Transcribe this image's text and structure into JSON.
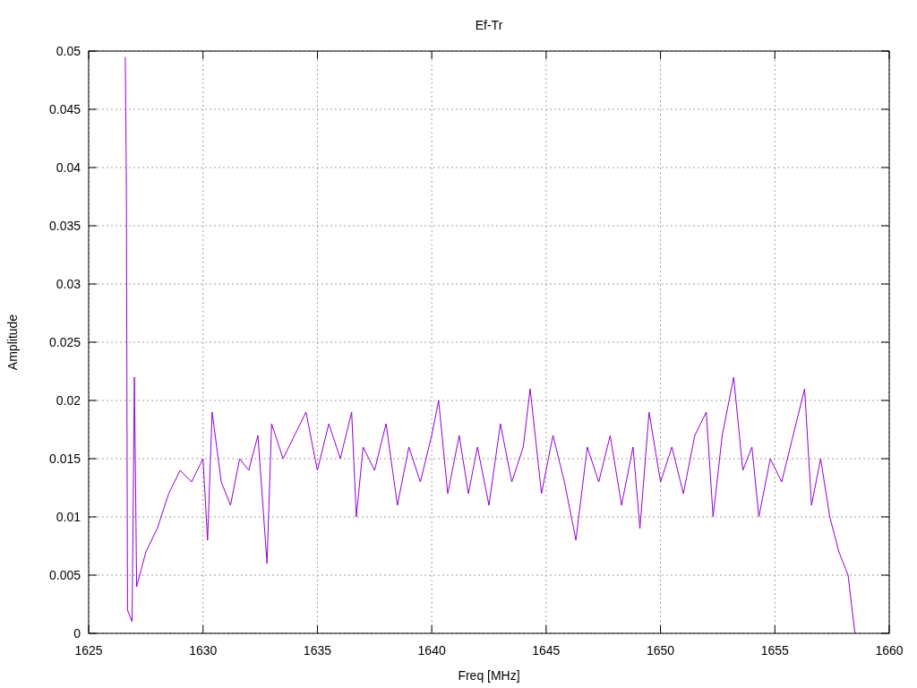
{
  "chart_data": {
    "type": "line",
    "title": "Ef-Tr",
    "xlabel": "Freq [MHz]",
    "ylabel": "Amplitude",
    "xlim": [
      1625,
      1660
    ],
    "ylim": [
      0,
      0.05
    ],
    "xticks": [
      1625,
      1630,
      1635,
      1640,
      1645,
      1650,
      1655,
      1660
    ],
    "grid": true,
    "yticks": [
      0,
      0.005,
      0.01,
      0.015,
      0.02,
      0.025,
      0.03,
      0.035,
      0.04,
      0.045,
      0.05
    ],
    "x": [
      1626.6,
      1626.65,
      1626.7,
      1626.9,
      1627.0,
      1627.1,
      1627.5,
      1628.0,
      1628.5,
      1629.0,
      1629.5,
      1630.0,
      1630.2,
      1630.4,
      1630.8,
      1631.2,
      1631.6,
      1632.0,
      1632.4,
      1632.8,
      1633.0,
      1633.5,
      1634.0,
      1634.5,
      1635.0,
      1635.5,
      1636.0,
      1636.5,
      1636.7,
      1637.0,
      1637.5,
      1638.0,
      1638.5,
      1639.0,
      1639.5,
      1640.0,
      1640.3,
      1640.7,
      1641.2,
      1641.6,
      1642.0,
      1642.5,
      1643.0,
      1643.5,
      1644.0,
      1644.3,
      1644.8,
      1645.3,
      1645.8,
      1646.3,
      1646.8,
      1647.3,
      1647.8,
      1648.3,
      1648.8,
      1649.1,
      1649.5,
      1650.0,
      1650.5,
      1651.0,
      1651.5,
      1652.0,
      1652.3,
      1652.7,
      1653.2,
      1653.6,
      1654.0,
      1654.3,
      1654.8,
      1655.3,
      1655.8,
      1656.3,
      1656.6,
      1657.0,
      1657.4,
      1657.8,
      1658.2,
      1658.5
    ],
    "series": [
      {
        "color": "#9400d3",
        "values": [
          0.0495,
          0.039,
          0.002,
          0.001,
          0.022,
          0.004,
          0.007,
          0.009,
          0.012,
          0.014,
          0.013,
          0.015,
          0.008,
          0.019,
          0.013,
          0.011,
          0.015,
          0.014,
          0.017,
          0.006,
          0.018,
          0.015,
          0.017,
          0.019,
          0.014,
          0.018,
          0.015,
          0.019,
          0.01,
          0.016,
          0.014,
          0.018,
          0.011,
          0.016,
          0.013,
          0.017,
          0.02,
          0.012,
          0.017,
          0.012,
          0.016,
          0.011,
          0.018,
          0.013,
          0.016,
          0.021,
          0.012,
          0.017,
          0.013,
          0.008,
          0.016,
          0.013,
          0.017,
          0.011,
          0.016,
          0.009,
          0.019,
          0.013,
          0.016,
          0.012,
          0.017,
          0.019,
          0.01,
          0.017,
          0.022,
          0.014,
          0.016,
          0.01,
          0.015,
          0.013,
          0.017,
          0.021,
          0.011,
          0.015,
          0.01,
          0.007,
          0.005,
          0
        ]
      }
    ]
  }
}
